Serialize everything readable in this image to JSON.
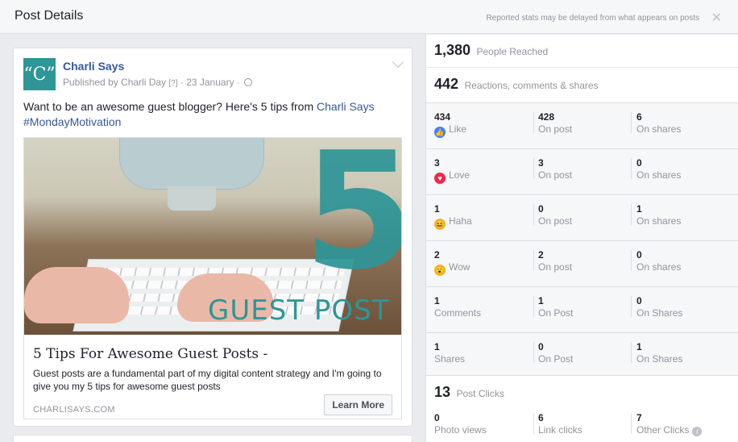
{
  "header": {
    "title": "Post Details",
    "note": "Reported stats may be delayed from what appears on posts",
    "close_symbol": "✕"
  },
  "post": {
    "avatar_text": "“C”",
    "page_name": "Charli Says",
    "byline_prefix": "Published by Charli Day",
    "byline_q": "[?]",
    "byline_date": "· 23 January ·",
    "text_before": "Want to be an awesome guest blogger? Here's 5 tips from",
    "text_link": "Charli Says",
    "hashtag": "#MondayMotivation",
    "image": {
      "big_number": "5",
      "caption": "GUEST POST"
    },
    "link_title": "5 Tips For Awesome Guest Posts -",
    "link_desc": "Guest posts are a fundamental part of my digital content strategy and I'm going to give you my 5 tips for awesome guest posts",
    "link_domain": "CHARLISAYS.COM",
    "cta": "Learn More"
  },
  "stats": {
    "reached": {
      "value": "1,380",
      "label": "People Reached"
    },
    "engagement": {
      "value": "442",
      "label": "Reactions, comments & shares"
    },
    "rows": [
      {
        "icon": "like-icon",
        "v1": "434",
        "l1": "Like",
        "v2": "428",
        "l2": "On post",
        "v3": "6",
        "l3": "On shares"
      },
      {
        "icon": "love-icon",
        "v1": "3",
        "l1": "Love",
        "v2": "3",
        "l2": "On post",
        "v3": "0",
        "l3": "On shares"
      },
      {
        "icon": "haha-icon",
        "v1": "1",
        "l1": "Haha",
        "v2": "0",
        "l2": "On post",
        "v3": "1",
        "l3": "On shares"
      },
      {
        "icon": "wow-icon",
        "v1": "2",
        "l1": "Wow",
        "v2": "2",
        "l2": "On post",
        "v3": "0",
        "l3": "On shares"
      },
      {
        "icon": "",
        "v1": "1",
        "l1": "Comments",
        "v2": "1",
        "l2": "On Post",
        "v3": "0",
        "l3": "On Shares"
      },
      {
        "icon": "",
        "v1": "1",
        "l1": "Shares",
        "v2": "0",
        "l2": "On Post",
        "v3": "1",
        "l3": "On Shares"
      }
    ],
    "clicks": {
      "value": "13",
      "label": "Post Clicks",
      "v1": "0",
      "l1": "Photo views",
      "v2": "6",
      "l2": "Link clicks",
      "v3": "7",
      "l3": "Other Clicks"
    }
  }
}
